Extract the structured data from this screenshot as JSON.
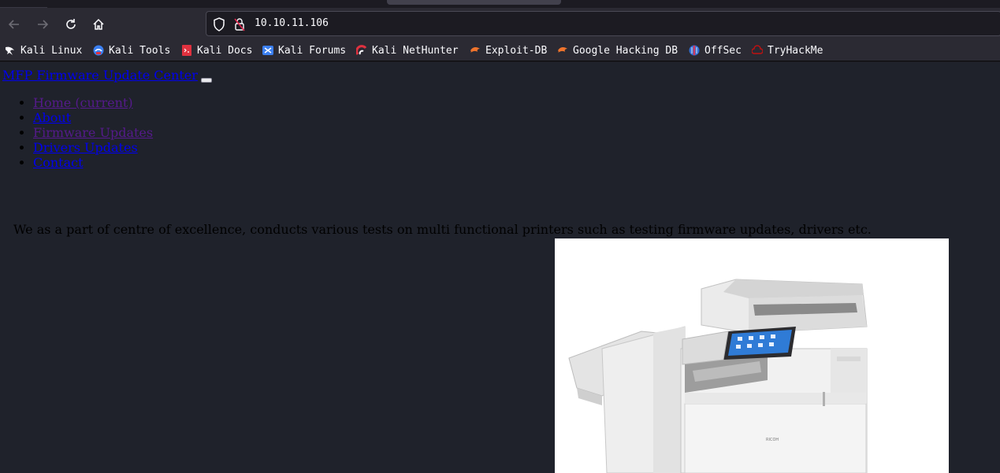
{
  "browser": {
    "url": "10.10.11.106",
    "bookmarks": [
      {
        "label": "Kali Linux",
        "icon": "kali-dragon-icon"
      },
      {
        "label": "Kali Tools",
        "icon": "kali-tools-icon"
      },
      {
        "label": "Kali Docs",
        "icon": "kali-docs-icon"
      },
      {
        "label": "Kali Forums",
        "icon": "kali-forums-icon"
      },
      {
        "label": "Kali NetHunter",
        "icon": "nethunter-icon"
      },
      {
        "label": "Exploit-DB",
        "icon": "exploit-db-icon"
      },
      {
        "label": "Google Hacking DB",
        "icon": "ghdb-icon"
      },
      {
        "label": "OffSec",
        "icon": "offsec-icon"
      },
      {
        "label": "TryHackMe",
        "icon": "tryhackme-icon"
      }
    ]
  },
  "site": {
    "brand": "MFP Firmware Update Center",
    "nav": [
      {
        "label": "Home (current)"
      },
      {
        "label": "About"
      },
      {
        "label": "Firmware Updates"
      },
      {
        "label": "Drivers Updates"
      },
      {
        "label": "Contact"
      }
    ],
    "intro": "We as a part of centre of excellence, conducts various tests on multi functional printers such as testing firmware updates, drivers etc."
  },
  "colors": {
    "chrome_bg": "#2b2a33",
    "page_bg": "#1f222b",
    "link": "#0000ee",
    "visited_link": "#551a8b"
  }
}
